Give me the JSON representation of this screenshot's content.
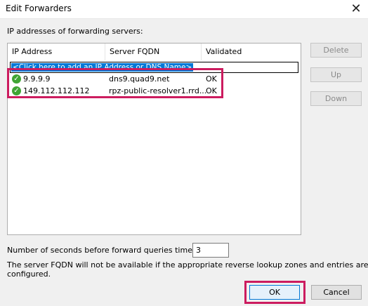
{
  "window": {
    "title": "Edit Forwarders",
    "close_glyph": "✕"
  },
  "servers_label": "IP addresses of forwarding servers:",
  "table": {
    "columns": [
      "IP Address",
      "Server FQDN",
      "Validated"
    ],
    "add_row_prompt": "<Click here to add an IP Address or DNS Name>",
    "rows": [
      {
        "ip": "9.9.9.9",
        "fqdn": "dns9.quad9.net",
        "validated": "OK",
        "status_icon": "check-circle-icon"
      },
      {
        "ip": "149.112.112.112",
        "fqdn": "rpz-public-resolver1.rrd...",
        "validated": "OK",
        "status_icon": "check-circle-icon"
      }
    ]
  },
  "side_buttons": {
    "delete": "Delete",
    "up": "Up",
    "down": "Down"
  },
  "timeout": {
    "label": "Number of seconds before forward queries time out:",
    "value": "3"
  },
  "note_line1": "The server FQDN will not be available if the appropriate reverse lookup zones and entries are not",
  "note_line2": "configured.",
  "buttons": {
    "ok": "OK",
    "cancel": "Cancel"
  },
  "colors": {
    "highlight": "#cc1c5f",
    "selection": "#0078d7",
    "check": "#3fa534"
  }
}
